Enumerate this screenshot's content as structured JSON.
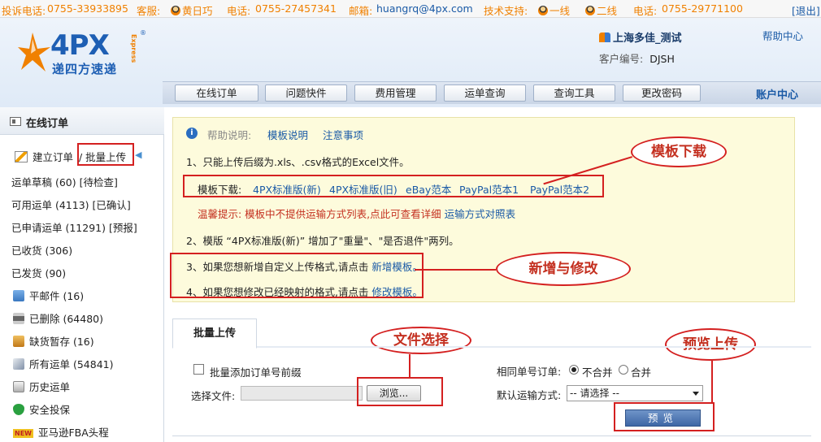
{
  "topbar": {
    "complaint_label": "投诉电话:",
    "complaint_phone": "0755-33933895",
    "service_label": "客服:",
    "service_name": "黄日巧",
    "phone_label": "电话:",
    "phone": "0755-27457341",
    "email_label": "邮箱:",
    "email": "huangrq@4px.com",
    "support_label": "技术支持:",
    "support_line1": "一线",
    "support_line2": "二线",
    "support_phone_label": "电话:",
    "support_phone": "0755-29771100",
    "logout": "[退出]"
  },
  "header": {
    "logo_brand": "4PX",
    "logo_cn": "递四方速递",
    "logo_express": "Express",
    "logo_reg": "®",
    "account_name": "上海多佳_测试",
    "customer_no_label": "客户编号:",
    "customer_no": "DJSH",
    "help_center": "帮助中心"
  },
  "nav": {
    "items": [
      "在线订单",
      "问题快件",
      "费用管理",
      "运单查询",
      "查询工具",
      "更改密码"
    ],
    "account_center": "账户中心"
  },
  "sidebar": {
    "title": "在线订单",
    "create_order": "建立订单",
    "batch_upload": "/ 批量上传",
    "items": [
      "运单草稿 (60) [待检查]",
      "可用运单 (4113) [已确认]",
      "已申请运单 (11291) [预报]",
      "已收货 (306)",
      "已发货 (90)"
    ],
    "icon_items": [
      {
        "label": "平邮件 (16)",
        "icon": "upload-icon",
        "color": "#4a8ad0"
      },
      {
        "label": "已删除 (64480)",
        "icon": "hourglass-icon",
        "color": "#8a8a8a"
      },
      {
        "label": "缺货暂存 (16)",
        "icon": "box-icon",
        "color": "#d8902a"
      },
      {
        "label": "所有运单 (54841)",
        "icon": "documents-icon",
        "color": "#7a8aa0"
      },
      {
        "label": "历史运单",
        "icon": "document-icon",
        "color": "#9a9a9a"
      },
      {
        "label": "安全投保",
        "icon": "shield-check-icon",
        "color": "#2aa040"
      },
      {
        "label": "亚马逊FBA头程",
        "icon": "new-badge-icon",
        "color": "#f0c020"
      }
    ],
    "new_badge": "NEW"
  },
  "help": {
    "label": "帮助说明:",
    "link1": "模板说明",
    "link2": "注意事项",
    "line1": "1、只能上传后缀为.xls、.csv格式的Excel文件。",
    "template_label": "模板下载:",
    "templates": [
      "4PX标准版(新)",
      "4PX标准版(旧)",
      "eBay范本",
      "PayPal范本1",
      "PayPal范本2"
    ],
    "tip_red": "温馨提示: 模板中不提供运输方式列表,点此可查看详细",
    "tip_link": "运输方式对照表",
    "line2": "2、模版 “4PX标准版(新)” 增加了\"重量\"、\"是否退件\"两列。",
    "line3_prefix": "3、如果您想新增自定义上传格式,请点击",
    "line3_link": "新增模板。",
    "line4_prefix": "4、如果您想修改已经映射的格式,请点击",
    "line4_link": "修改模板。"
  },
  "callouts": {
    "template_download": "模板下载",
    "add_modify": "新增与修改",
    "file_select": "文件选择",
    "preview_upload": "预览上传"
  },
  "upload": {
    "tab": "批量上传",
    "add_prefix_label": "批量添加订单号前缀",
    "select_file_label": "选择文件:",
    "browse_button": "浏览...",
    "same_order_label": "相同单号订单:",
    "opt_no_merge": "不合并",
    "opt_merge": "合并",
    "default_ship_label": "默认运输方式:",
    "ship_select_value": "-- 请选择 --",
    "preview_button": "预览"
  },
  "colors": {
    "brand_blue": "#1e5fb4",
    "orange": "#f08000",
    "highlight_red": "#d42020",
    "help_bg": "#fdfbdc"
  }
}
